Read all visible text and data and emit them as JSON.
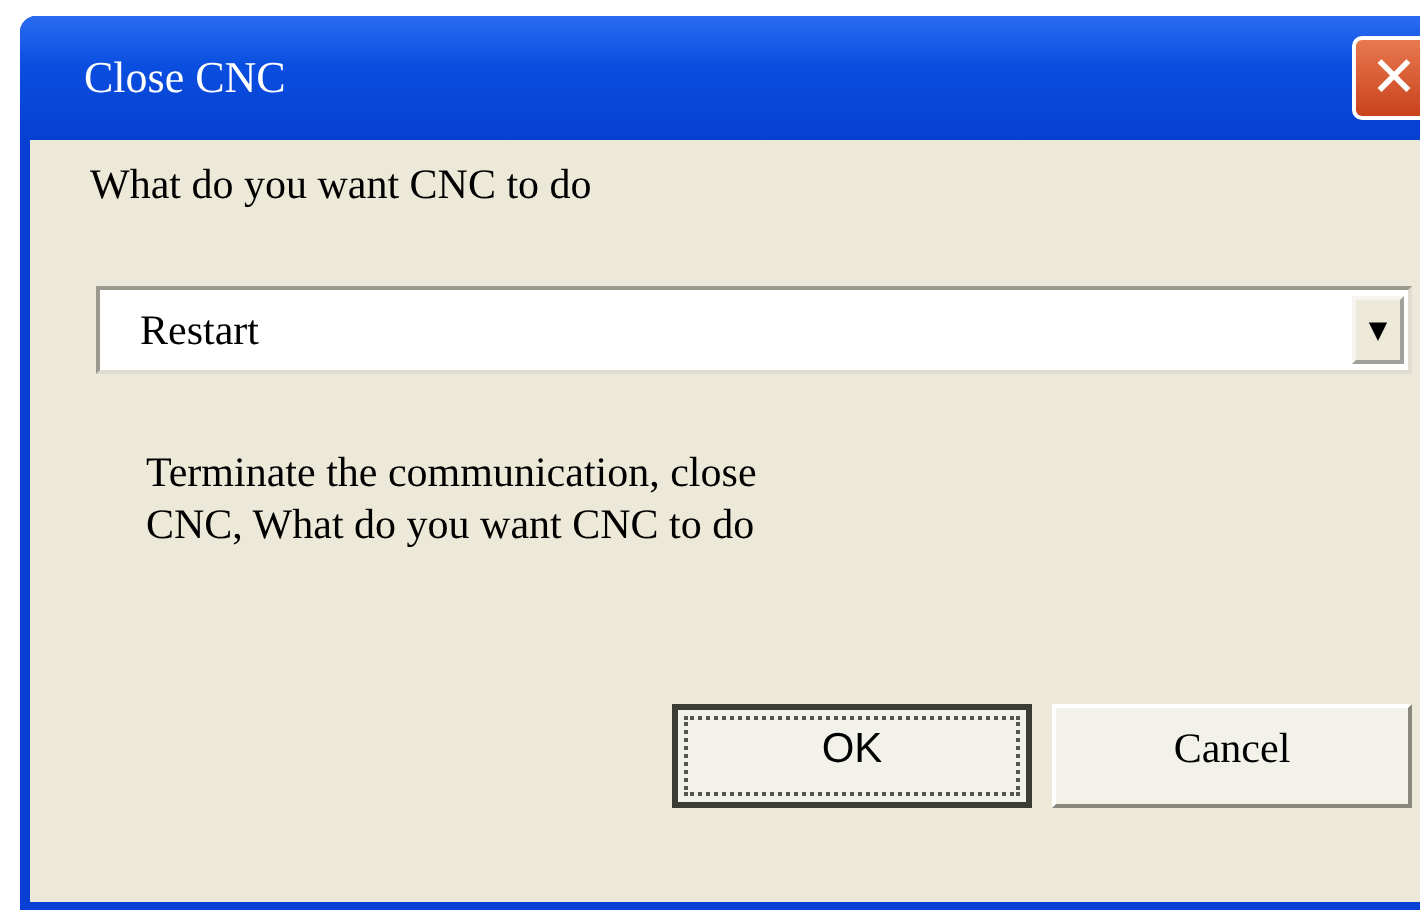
{
  "window": {
    "title": "Close CNC",
    "close_glyph": "✕"
  },
  "prompt": "What do you want CNC to do",
  "dropdown": {
    "value": "Restart",
    "arrow": "▼"
  },
  "description": "Terminate the communication, close CNC, What do you want CNC to do",
  "buttons": [
    {
      "label": "OK",
      "focused": true
    },
    {
      "label": "Cancel",
      "focused": false
    }
  ]
}
